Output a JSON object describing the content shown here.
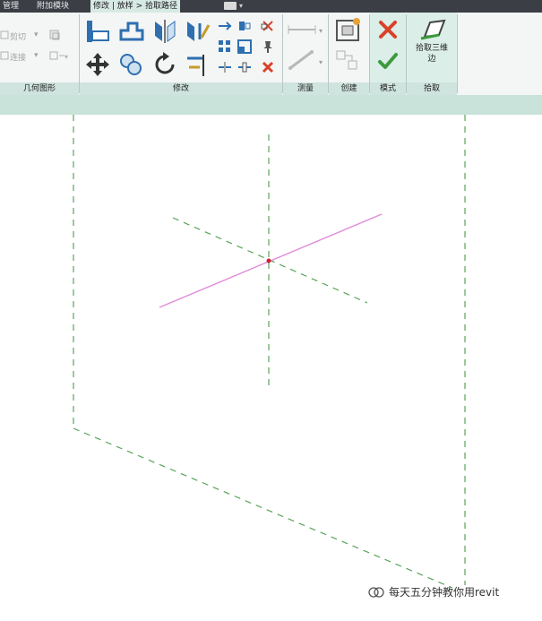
{
  "tabs": [
    {
      "label": "管理",
      "active": false
    },
    {
      "label": "附加模块",
      "active": false
    },
    {
      "label": "修改 | 放样 > 拾取路径",
      "active": true
    }
  ],
  "ribbon": {
    "geometry": {
      "label": "几何图形",
      "items": [
        "剪切",
        "连接"
      ]
    },
    "modify": {
      "label": "修改"
    },
    "measure": {
      "label": "测量"
    },
    "create": {
      "label": "创建"
    },
    "mode": {
      "label": "模式"
    },
    "pick": {
      "label": "拾取",
      "button": "拾取三维\n边"
    }
  },
  "colors": {
    "accent_green": "#3d9a3d",
    "cancel_red": "#d9412b",
    "path_line": "#e08ad8",
    "ref_dash": "#5aa35a",
    "point": "#cc2233"
  },
  "watermark": "每天五分钟教你用revit"
}
